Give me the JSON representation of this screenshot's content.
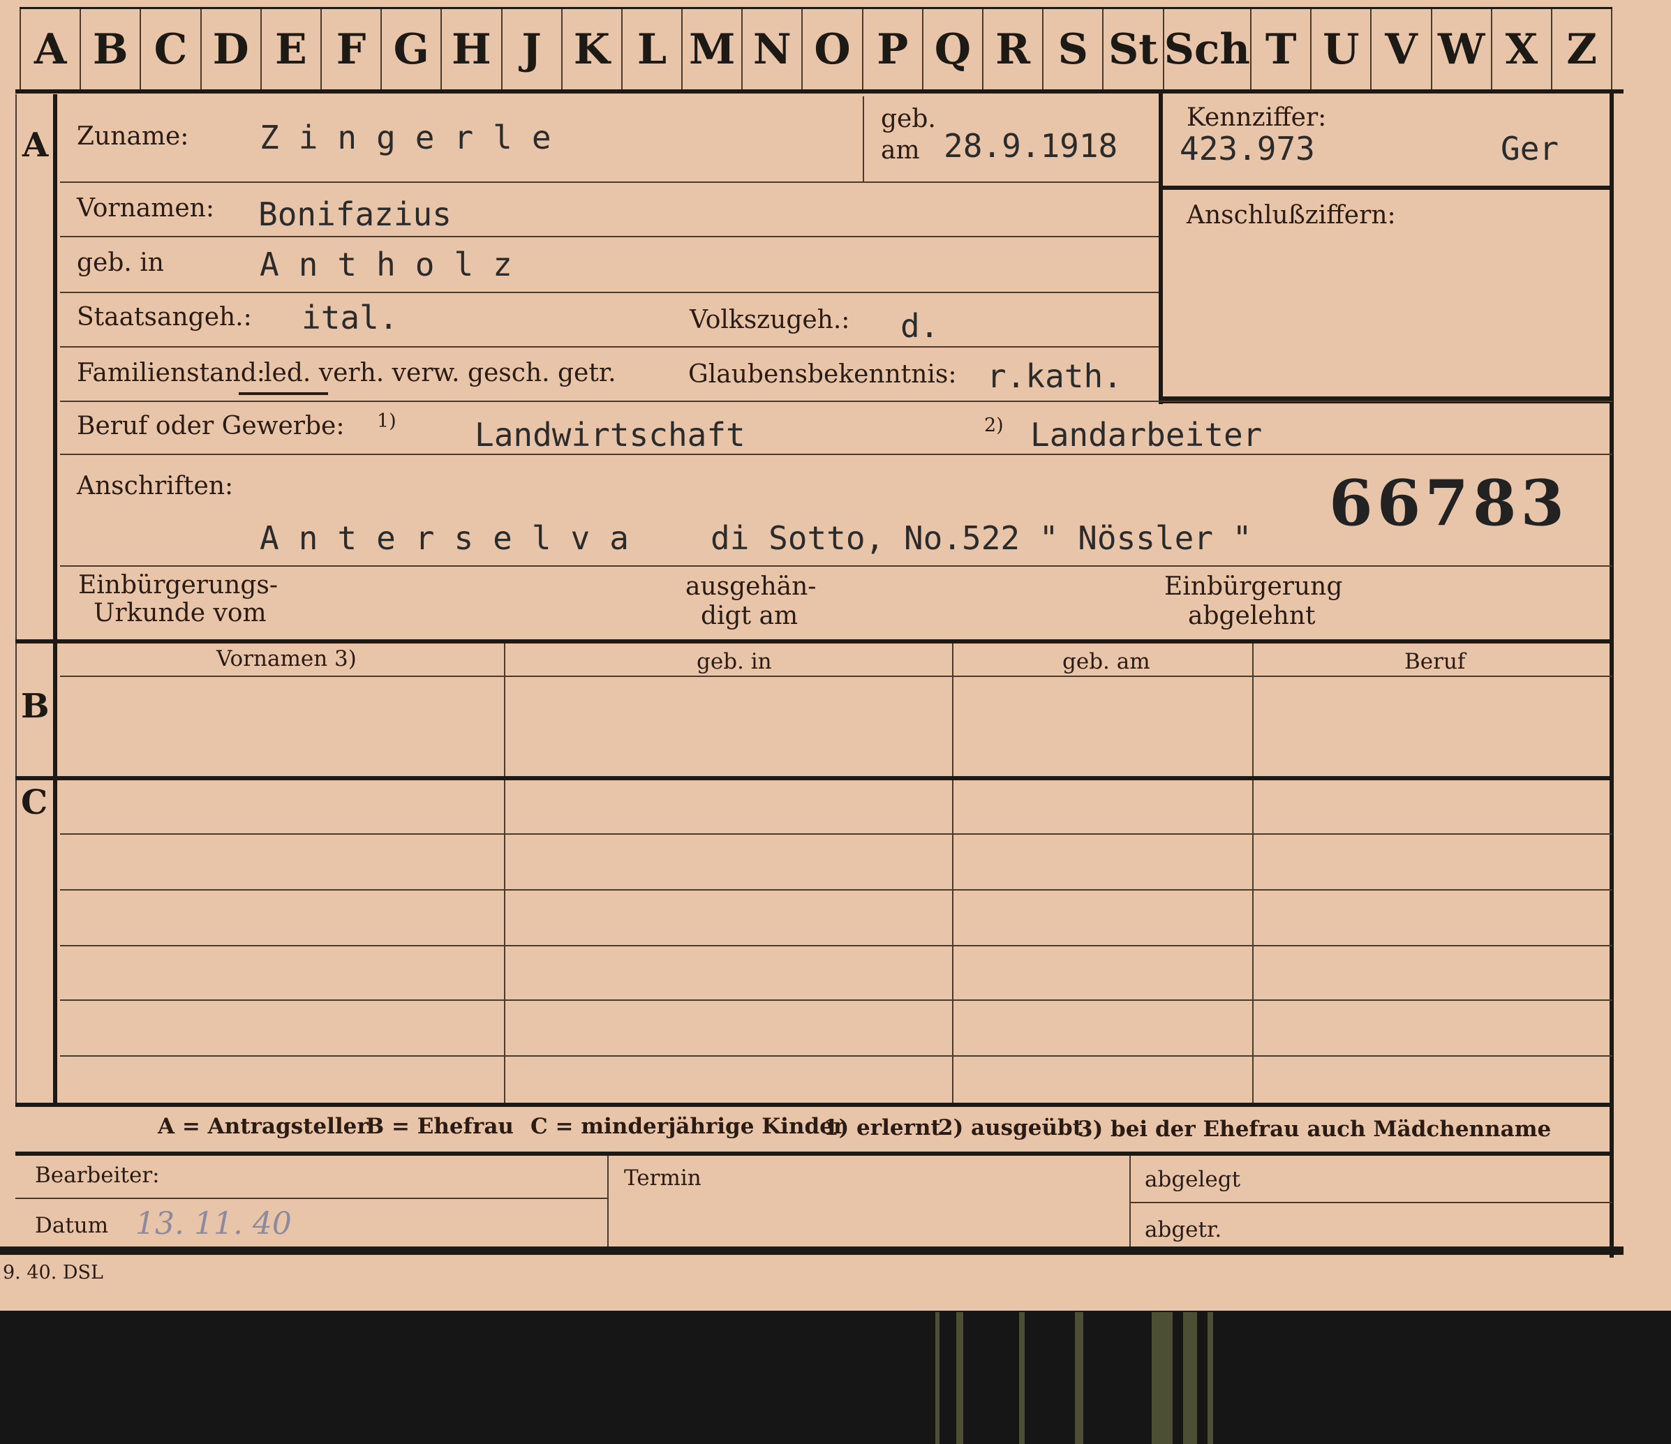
{
  "alphabet_tabs": [
    "A",
    "B",
    "C",
    "D",
    "E",
    "F",
    "G",
    "H",
    "J",
    "K",
    "L",
    "M",
    "N",
    "O",
    "P",
    "Q",
    "R",
    "S",
    "St",
    "Sch",
    "T",
    "U",
    "V",
    "W",
    "X",
    "Z"
  ],
  "sections": {
    "a": "A",
    "b": "B",
    "c": "C"
  },
  "fields": {
    "zuname_label": "Zuname:",
    "zuname_value": "Zingerle",
    "geb_label": "geb.",
    "am_label": "am",
    "geb_am_value": "28.9.1918",
    "kennziffer_label": "Kennziffer:",
    "kennziffer_value": "423.973",
    "kennziffer_code": "Ger",
    "vornamen_label": "Vornamen:",
    "vornamen_value": "Bonifazius",
    "anschluss_label": "Anschlußziffern:",
    "geb_in_label": "geb. in",
    "geb_in_value": "Antholz",
    "staatsangeh_label": "Staatsangeh.:",
    "staatsangeh_value": "ital.",
    "volkszugeh_label": "Volkszugeh.:",
    "volkszugeh_value": "d.",
    "familienstand_label": "Familienstand:",
    "familienstand_options": "led. verh. verw. gesch. getr.",
    "glauben_label": "Glaubensbekenntnis:",
    "glauben_value": "r.kath.",
    "beruf_label": "Beruf oder Gewerbe:",
    "beruf_note1": "1)",
    "beruf_value1": "Landwirtschaft",
    "beruf_note2": "2)",
    "beruf_value2": "Landarbeiter",
    "anschriften_label": "Anschriften:",
    "anschriften_value_spaced": "Anterselva",
    "anschriften_value_rest": "di Sotto, No.522 \" Nössler \"",
    "file_number": "66783",
    "einbuergerung_urkunde_l1": "Einbürgerungs-",
    "einbuergerung_urkunde_l2": "Urkunde vom",
    "ausgehaendigt_l1": "ausgehän-",
    "ausgehaendigt_l2": "digt am",
    "einbuergerung_abgelehnt_l1": "Einbürgerung",
    "einbuergerung_abgelehnt_l2": "abgelehnt"
  },
  "family_table": {
    "headers": [
      "Vornamen 3)",
      "geb. in",
      "geb. am",
      "Beruf"
    ]
  },
  "legend": {
    "a": "A = Antragsteller",
    "b": "B = Ehefrau",
    "c": "C = minderjährige Kinder",
    "n1": "1) erlernt",
    "n2": "2) ausgeübt",
    "n3": "3) bei der Ehefrau auch Mädchenname"
  },
  "footer": {
    "bearbeiter_label": "Bearbeiter:",
    "termin_label": "Termin",
    "abgelegt_label": "abgelegt",
    "datum_label": "Datum",
    "datum_value": "13. 11. 40",
    "abgetr_label": "abgetr.",
    "print_code": "9. 40. DSL"
  }
}
